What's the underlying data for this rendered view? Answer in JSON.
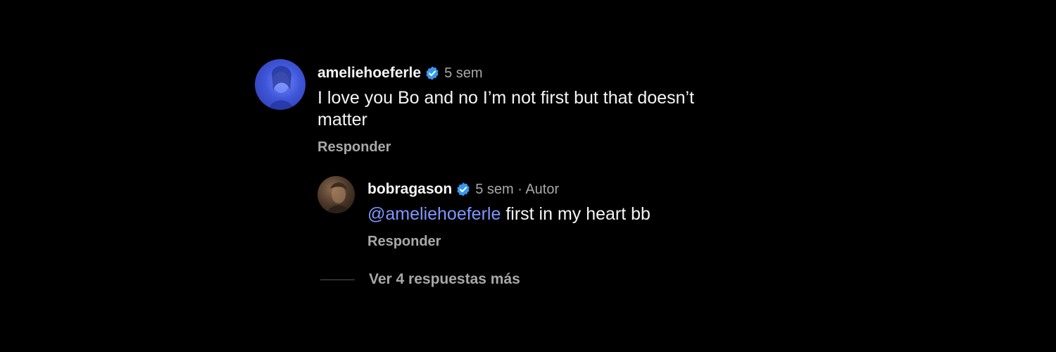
{
  "colors": {
    "background": "#000000",
    "text_primary": "#f5f5f5",
    "text_secondary": "#a8a8a8",
    "mention": "#7f97ff",
    "verified_badge": "#3797f0"
  },
  "comment": {
    "username": "ameliehoeferle",
    "verified_icon": "verified-badge-icon",
    "time": "5 sem",
    "text": "I love you Bo and no I’m not first but that doesn’t matter",
    "reply_label": "Responder"
  },
  "reply": {
    "username": "bobragason",
    "verified_icon": "verified-badge-icon",
    "meta": "5 sem · Autor",
    "mention": "@ameliehoeferle",
    "text": " first in my heart bb",
    "reply_label": "Responder"
  },
  "more_replies": {
    "label": "Ver 4 respuestas más"
  }
}
